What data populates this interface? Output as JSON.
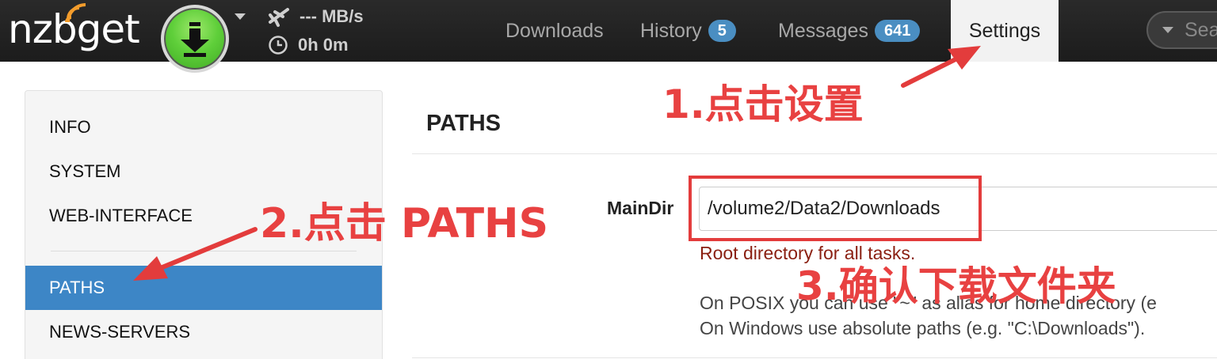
{
  "app": {
    "logo_text": "nzbget",
    "speed": "--- MB/s",
    "remaining_time": "0h 0m"
  },
  "nav": {
    "downloads": "Downloads",
    "history": "History",
    "history_badge": "5",
    "messages": "Messages",
    "messages_badge": "641",
    "settings": "Settings",
    "search_placeholder": "Sea"
  },
  "sidebar": {
    "items": [
      {
        "label": "INFO"
      },
      {
        "label": "SYSTEM"
      },
      {
        "label": "WEB-INTERFACE"
      },
      {
        "label": "PATHS"
      },
      {
        "label": "NEWS-SERVERS"
      }
    ]
  },
  "content": {
    "section_title": "PATHS",
    "maindir": {
      "label": "MainDir",
      "value": "/volume2/Data2/Downloads",
      "description": "Root directory for all tasks.",
      "help_posix": "On POSIX you can use \"~\" as alias for home directory (e",
      "help_windows": "On Windows use absolute paths (e.g. \"C:\\Downloads\")."
    }
  },
  "annotations": {
    "step1": "1.点击设置",
    "step2": "2.点击 PATHS",
    "step3": "3.确认下载文件夹",
    "color": "#e84141"
  },
  "colors": {
    "navbar": "#1f1f1f",
    "badge": "#4a8ec2",
    "active_sidebar": "#3d86c6",
    "description_text": "#8a1f11",
    "download_button": "#5fcf3a"
  },
  "icons": [
    "signal-icon",
    "download-arrow-icon",
    "plane-icon",
    "clock-icon",
    "caret-down-icon"
  ]
}
